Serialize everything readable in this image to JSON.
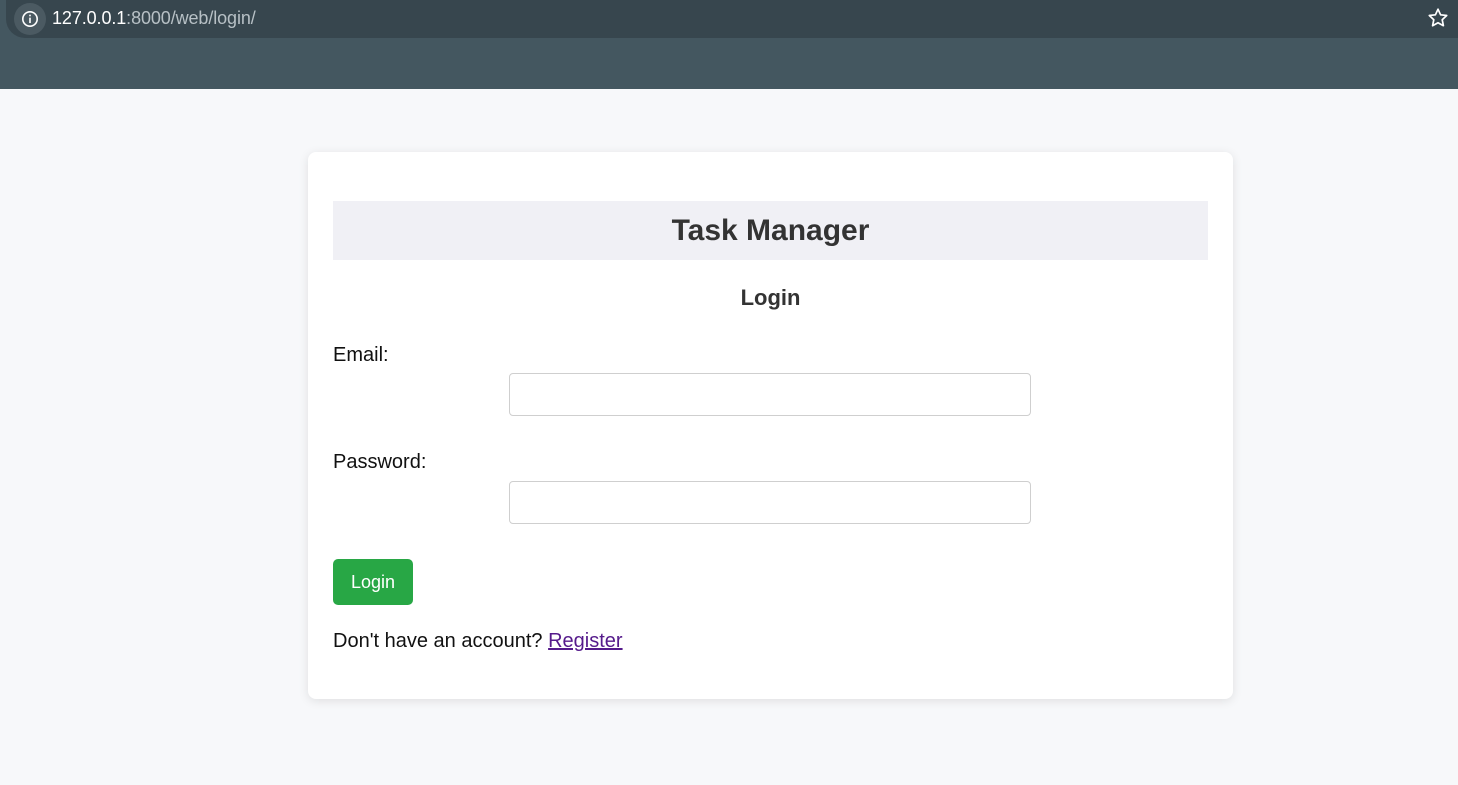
{
  "browser": {
    "url_host": "127.0.0.1",
    "url_rest": ":8000/web/login/"
  },
  "card": {
    "app_title": "Task Manager",
    "form_title": "Login"
  },
  "form": {
    "email_label": "Email:",
    "email_value": "",
    "password_label": "Password:",
    "password_value": "",
    "submit_label": "Login"
  },
  "footer": {
    "prompt": "Don't have an account?",
    "register_label": "Register"
  },
  "colors": {
    "accent": "#28a745",
    "link_visited": "#551a8b",
    "browser_frame": "#445760"
  },
  "icons": {
    "site_info": "info-icon",
    "bookmark": "star-icon"
  }
}
